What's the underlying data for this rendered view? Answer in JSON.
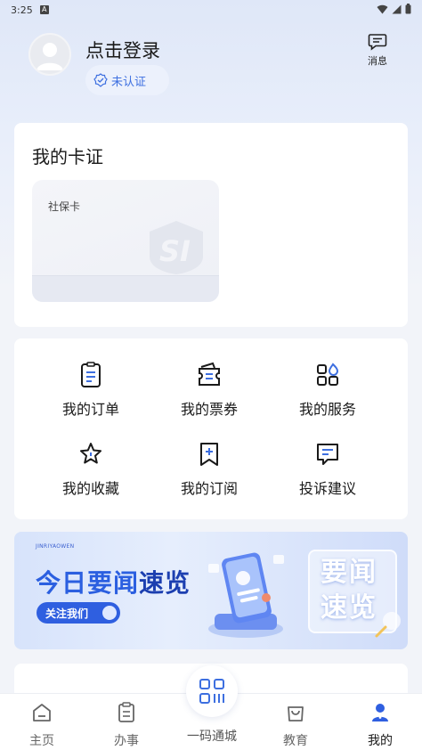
{
  "status_bar": {
    "time": "3:25",
    "notification_badge": "A"
  },
  "profile": {
    "login_text": "点击登录",
    "verify_status": "未认证",
    "message_label": "消息"
  },
  "cards_section": {
    "title": "我的卡证",
    "social_security_card": {
      "label": "社保卡",
      "logo_text": "SI"
    }
  },
  "services": [
    {
      "label": "我的订单",
      "icon": "order-icon"
    },
    {
      "label": "我的票券",
      "icon": "ticket-icon"
    },
    {
      "label": "我的服务",
      "icon": "services-grid-icon"
    },
    {
      "label": "我的收藏",
      "icon": "star-icon"
    },
    {
      "label": "我的订阅",
      "icon": "bookmark-plus-icon"
    },
    {
      "label": "投诉建议",
      "icon": "feedback-icon"
    }
  ],
  "banner": {
    "tiny_text": "JINRIYAOWEN",
    "headline_a": "今日要闻",
    "headline_b": "速览",
    "follow_button": "关注我们",
    "side_text_line1": "要闻",
    "side_text_line2": "速览"
  },
  "tabbar": {
    "tabs": [
      {
        "label": "主页",
        "icon": "home-icon"
      },
      {
        "label": "办事",
        "icon": "clipboard-icon"
      },
      {
        "label": "一码通城",
        "icon": "qr-code-icon"
      },
      {
        "label": "教育",
        "icon": "bag-icon"
      },
      {
        "label": "我的",
        "icon": "person-icon"
      }
    ],
    "active_tab": "我的"
  },
  "colors": {
    "accent": "#3d6fe0",
    "banner_blue": "#2b5fe0",
    "text_primary": "#1a1a1a",
    "page_background": "#f2f4f9"
  }
}
